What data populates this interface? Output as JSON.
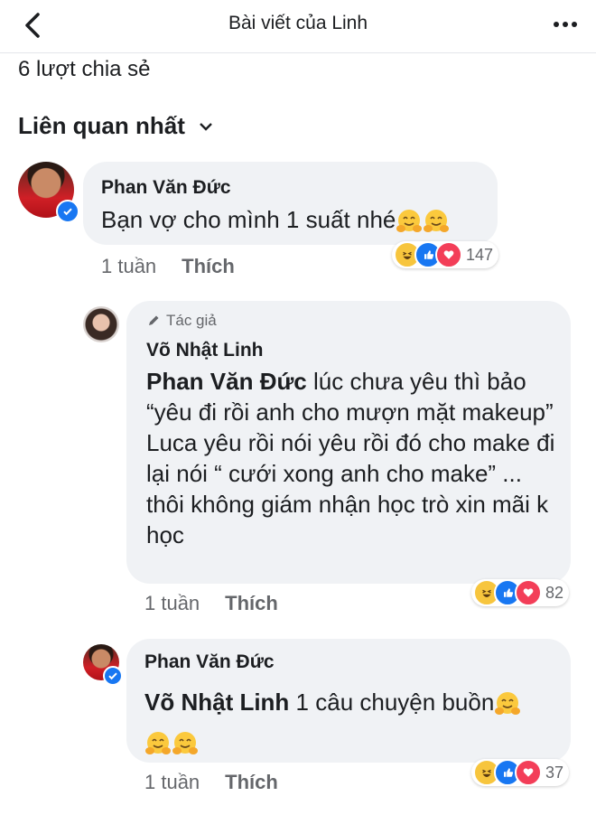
{
  "header": {
    "title": "Bài viết của Linh"
  },
  "shares": "6 lượt chia sẻ",
  "sort_label": "Liên quan nhất",
  "comments": [
    {
      "author": "Phan Văn Đức",
      "text": "Bạn vợ cho mình 1 suất nhé",
      "time": "1 tuần",
      "like_label": "Thích",
      "reaction_count": "147"
    },
    {
      "author_tag": "Tác giả",
      "author": "Võ Nhật Linh",
      "mention": "Phan Văn Đức",
      "text_line1": " lúc chưa yêu thì bảo",
      "text_rest": "“yêu đi rồi anh cho mượn mặt makeup”",
      "text_p2": "Luca yêu rồi nói yêu rồi đó cho make đi lại nói “ cưới xong anh cho make” ... thôi không giám nhận học trò xin mãi k học",
      "time": "1 tuần",
      "like_label": "Thích",
      "reaction_count": "82"
    },
    {
      "author": "Phan Văn Đức",
      "mention": "Võ Nhật Linh",
      "text": " 1 câu chuyện buồn",
      "time": "1 tuần",
      "like_label": "Thích",
      "reaction_count": "37"
    }
  ]
}
